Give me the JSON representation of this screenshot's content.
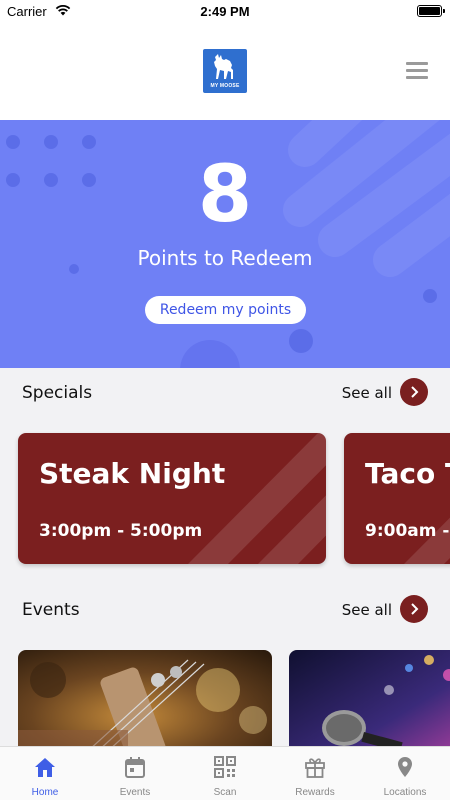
{
  "status_bar": {
    "carrier": "Carrier",
    "time": "2:49 PM"
  },
  "header": {
    "logo_text": "MY MOOSE",
    "logo_color": "#2f6fcf"
  },
  "hero": {
    "points": "8",
    "points_label": "Points to Redeem",
    "redeem_button": "Redeem my points",
    "background_color": "#6f80f5"
  },
  "specials": {
    "title": "Specials",
    "see_all": "See all",
    "items": [
      {
        "title": "Steak Night",
        "time": "3:00pm - 5:00pm"
      },
      {
        "title": "Taco T",
        "time": "9:00am -"
      }
    ],
    "card_color": "#7b1f1f"
  },
  "events": {
    "title": "Events",
    "see_all": "See all"
  },
  "tabbar": {
    "items": [
      {
        "label": "Home",
        "icon": "home-icon",
        "active": true
      },
      {
        "label": "Events",
        "icon": "calendar-icon",
        "active": false
      },
      {
        "label": "Scan",
        "icon": "qr-code-icon",
        "active": false
      },
      {
        "label": "Rewards",
        "icon": "gift-icon",
        "active": false
      },
      {
        "label": "Locations",
        "icon": "location-pin-icon",
        "active": false
      }
    ],
    "active_color": "#3f5ee6",
    "inactive_color": "#888888"
  }
}
